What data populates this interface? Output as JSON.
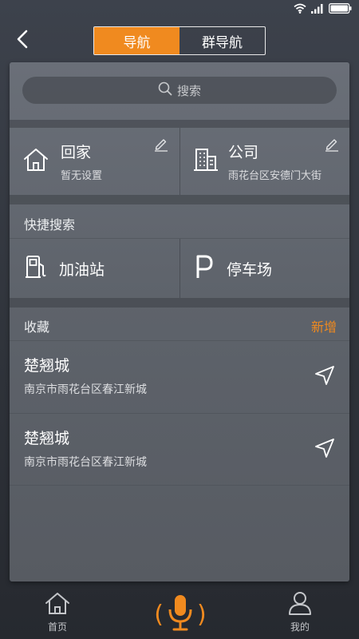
{
  "tabs": {
    "nav": "导航",
    "group_nav": "群导航"
  },
  "search": {
    "placeholder": "搜索"
  },
  "home": {
    "title": "回家",
    "subtitle": "暂无设置"
  },
  "company": {
    "title": "公司",
    "subtitle": "雨花台区安德门大街"
  },
  "quick_search": {
    "title": "快捷搜索",
    "items": [
      {
        "label": "加油站",
        "icon": "gas-station-icon"
      },
      {
        "label": "停车场",
        "icon": "parking-icon"
      }
    ]
  },
  "favorites": {
    "title": "收藏",
    "add_label": "新增",
    "items": [
      {
        "name": "楚翘城",
        "address": "南京市雨花台区春江新城"
      },
      {
        "name": "楚翘城",
        "address": "南京市雨花台区春江新城"
      }
    ]
  },
  "bottom_nav": {
    "home": "首页",
    "mine": "我的"
  },
  "colors": {
    "accent": "#f08a1f"
  }
}
